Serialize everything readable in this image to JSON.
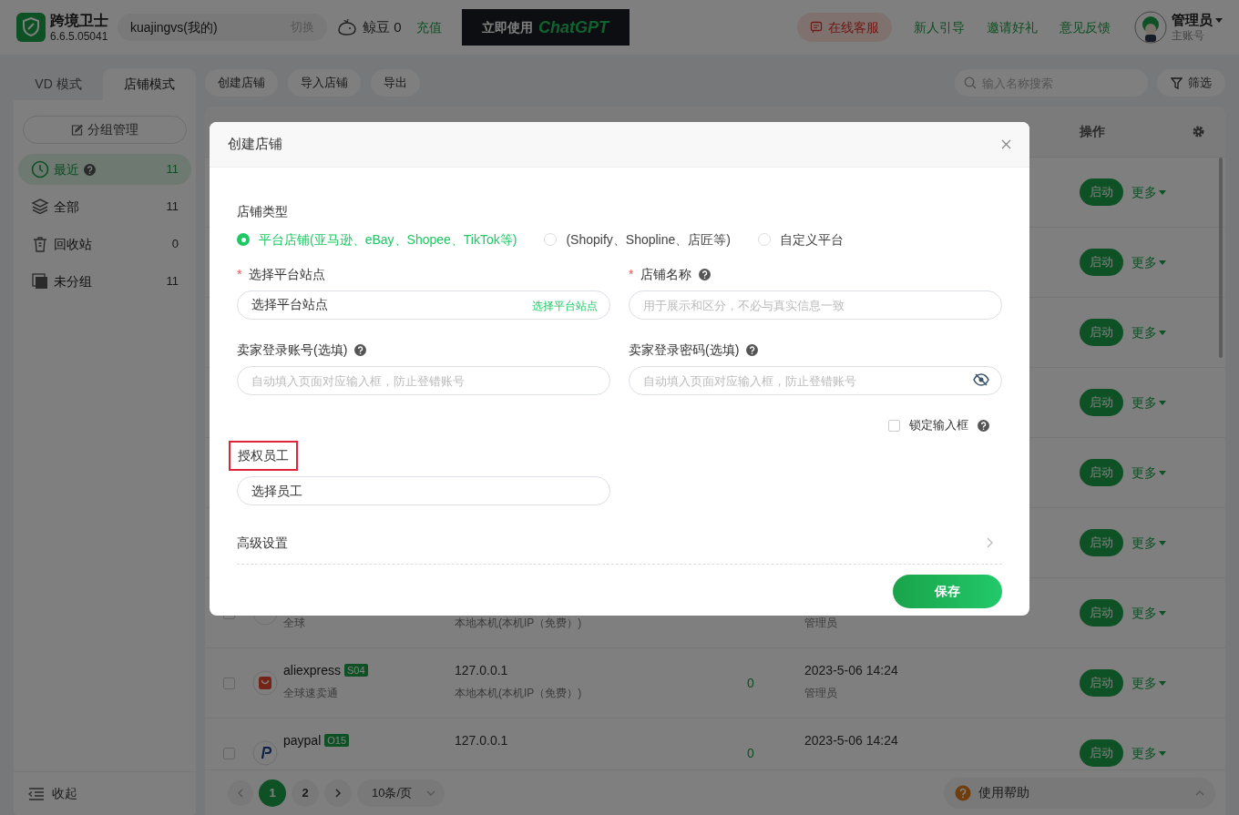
{
  "header": {
    "app_name": "跨境卫士",
    "version": "6.6.5.05041",
    "account": {
      "value": "kuajingvs(我的)",
      "action": "切换"
    },
    "beans": "鲸豆 0",
    "recharge": "充值",
    "banner": {
      "lead": "立即使用",
      "brand": "ChatGPT"
    },
    "nav": [
      {
        "label": "在线客服",
        "kind": "service"
      },
      {
        "label": "新人引导",
        "kind": "link"
      },
      {
        "label": "邀请好礼",
        "kind": "link"
      },
      {
        "label": "意见反馈",
        "kind": "link"
      }
    ],
    "user": {
      "name": "管理员",
      "role": "主账号"
    }
  },
  "sidebar": {
    "tabs": [
      {
        "label": "VD 模式",
        "selected": false
      },
      {
        "label": "店铺模式",
        "selected": true
      }
    ],
    "group_button": "分组管理",
    "items": [
      {
        "label": "最近",
        "count": "11",
        "selected": true,
        "help": true,
        "kind": "clock"
      },
      {
        "label": "全部",
        "count": "11",
        "selected": false,
        "help": false,
        "kind": "layers"
      },
      {
        "label": "回收站",
        "count": "0",
        "selected": false,
        "help": false,
        "kind": "trash"
      },
      {
        "label": "未分组",
        "count": "11",
        "selected": false,
        "help": false,
        "kind": "square"
      }
    ],
    "collapse": "收起"
  },
  "toolbar": {
    "buttons": [
      "创建店铺",
      "导入店铺",
      "导出"
    ],
    "search_placeholder": "输入名称搜索",
    "filter": "筛选"
  },
  "table": {
    "action_header": "操作",
    "rows": [
      {
        "action": "启动",
        "more": "更多"
      },
      {
        "action": "启动",
        "more": "更多"
      },
      {
        "action": "启动",
        "more": "更多"
      },
      {
        "action": "启动",
        "more": "更多"
      },
      {
        "action": "启动",
        "more": "更多"
      },
      {
        "action": "启动",
        "more": "更多"
      },
      {
        "kind": "generic",
        "checked": false,
        "subtitle": "全球",
        "ip_note": "本地本机(本机IP（免费）)",
        "owner": "管理员",
        "action": "启动",
        "more": "更多"
      },
      {
        "kind": "bag",
        "checked": false,
        "name": "aliexpress",
        "tag": "S04",
        "subtitle": "全球速卖通",
        "ip": "127.0.0.1",
        "ip_note": "本地本机(本机IP（免费）)",
        "count": "0",
        "time": "2023-5-06 14:24",
        "owner": "管理员",
        "action": "启动",
        "more": "更多"
      },
      {
        "kind": "letter",
        "checked": false,
        "name": "paypal",
        "tag": "O15",
        "ip": "127.0.0.1",
        "count": "0",
        "time": "2023-5-06 14:24",
        "action": "启动",
        "more": "更多"
      }
    ]
  },
  "pagination": {
    "pages": [
      {
        "label": "1",
        "selected": true
      },
      {
        "label": "2",
        "selected": false
      }
    ],
    "page_size": "10条/页",
    "help": "使用帮助"
  },
  "dialog": {
    "title": "创建店铺",
    "store_type_label": "店铺类型",
    "store_types": [
      {
        "label": "平台店铺(亚马逊、eBay、Shopee、TikTok等)",
        "selected": true
      },
      {
        "label": "(Shopify、Shopline、店匠等)",
        "selected": false
      },
      {
        "label": "自定义平台",
        "selected": false
      }
    ],
    "site": {
      "label": "选择平台站点",
      "required_mark": "*",
      "value": "选择平台站点",
      "action": "选择平台站点"
    },
    "store_name": {
      "label": "店铺名称",
      "required_mark": "*",
      "help": true,
      "placeholder": "用于展示和区分，不必与真实信息一致"
    },
    "account": {
      "label": "卖家登录账号(选填)",
      "help": true,
      "placeholder": "自动填入页面对应输入框，防止登错账号"
    },
    "password": {
      "label": "卖家登录密码(选填)",
      "help": true,
      "placeholder": "自动填入页面对应输入框，防止登错账号"
    },
    "lock": {
      "label": "锁定输入框",
      "checked": false
    },
    "staff": {
      "label": "授权员工",
      "highlighted": true,
      "value": "选择员工"
    },
    "advanced": "高级设置",
    "save": "保存"
  }
}
